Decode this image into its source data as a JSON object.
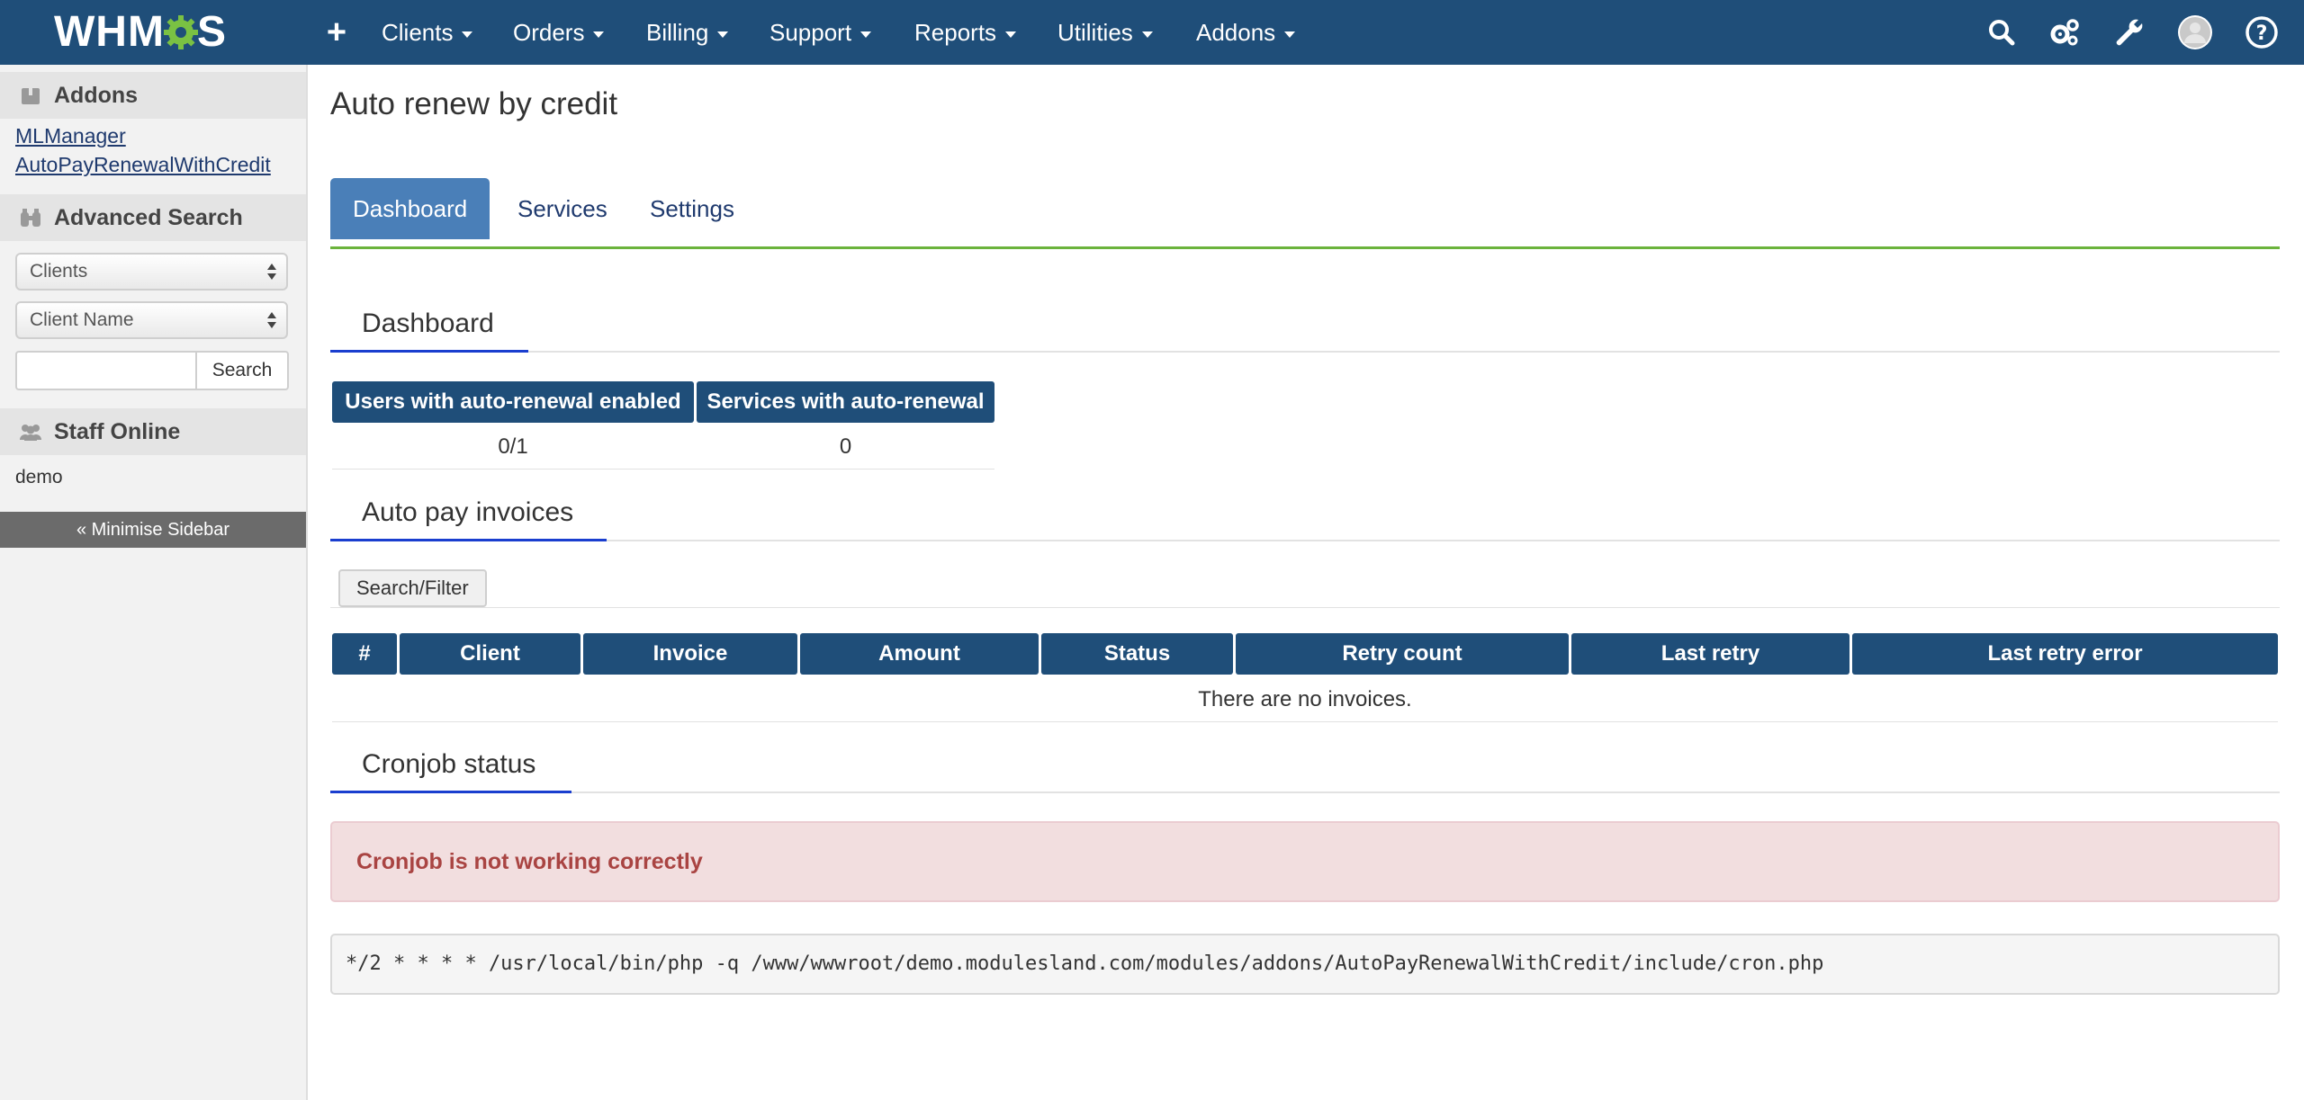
{
  "navbar": {
    "logo": "WHMCS",
    "plus": "+",
    "items": [
      "Clients",
      "Orders",
      "Billing",
      "Support",
      "Reports",
      "Utilities",
      "Addons"
    ],
    "icons": [
      "search-icon",
      "gears-icon",
      "wrench-icon",
      "avatar-icon",
      "help-icon"
    ],
    "color": "#1f4e79"
  },
  "sidebar": {
    "addons_title": "Addons",
    "addons_links": [
      "MLManager",
      "AutoPayRenewalWithCredit"
    ],
    "advanced_title": "Advanced Search",
    "select_1": "Clients",
    "select_2": "Client Name",
    "search_value": "",
    "search_button": "Search",
    "staff_title": "Staff Online",
    "staff_user": "demo",
    "minimise": "« Minimise Sidebar"
  },
  "main": {
    "title": "Auto renew by credit",
    "tabs": [
      "Dashboard",
      "Services",
      "Settings"
    ],
    "active_tab": "Dashboard",
    "dashboard": {
      "title": "Dashboard",
      "headers": [
        "Users with auto-renewal enabled",
        "Services with auto-renewal"
      ],
      "values": [
        "0/1",
        "0"
      ]
    },
    "invoices": {
      "title": "Auto pay invoices",
      "filter_button": "Search/Filter",
      "headers": [
        "#",
        "Client",
        "Invoice",
        "Amount",
        "Status",
        "Retry count",
        "Last retry",
        "Last retry error"
      ],
      "empty": "There are no invoices."
    },
    "cron": {
      "title": "Cronjob status",
      "alert": "Cronjob is not working correctly",
      "command": "*/2 * * * * /usr/local/bin/php -q /www/wwwroot/demo.modulesland.com/modules/addons/AutoPayRenewalWithCredit/include/cron.php"
    }
  }
}
